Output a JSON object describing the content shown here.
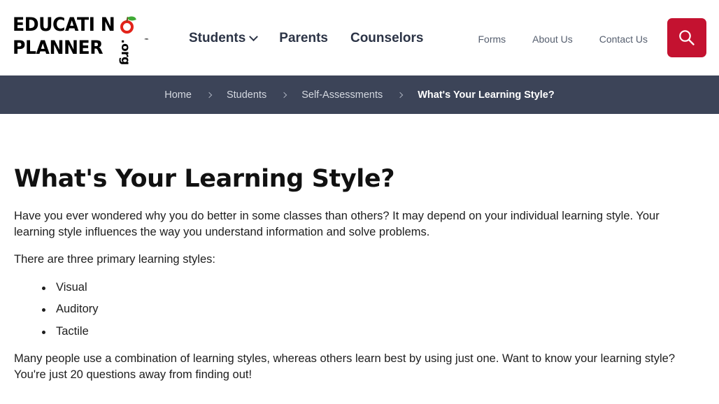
{
  "header": {
    "logo": {
      "line1": "EDUCATI N",
      "line2": "PLANNER",
      "suffix": ".org",
      "trademark": "™",
      "apple_color": "#e2231a",
      "leaf_color": "#3faa35"
    },
    "primary_nav": [
      {
        "label": "Students",
        "has_dropdown": true
      },
      {
        "label": "Parents",
        "has_dropdown": false
      },
      {
        "label": "Counselors",
        "has_dropdown": false
      }
    ],
    "secondary_nav": [
      {
        "label": "Forms"
      },
      {
        "label": "About Us"
      },
      {
        "label": "Contact Us"
      }
    ],
    "search": {
      "icon": "search-icon",
      "button_color": "#c41230",
      "aria_label": "Search"
    }
  },
  "breadcrumb": {
    "bar_color": "#3c4458",
    "items": [
      {
        "label": "Home",
        "current": false
      },
      {
        "label": "Students",
        "current": false
      },
      {
        "label": "Self-Assessments",
        "current": false
      },
      {
        "label": "What's Your Learning Style?",
        "current": true
      }
    ],
    "separator": "chevron-right-icon"
  },
  "main": {
    "title": "What's Your Learning Style?",
    "paragraph_1": "Have you ever wondered why you do better in some classes than others? It may depend on your individual learning style. Your learning style influences the way you understand information and solve problems.",
    "paragraph_2": "There are three primary learning styles:",
    "learning_styles": [
      "Visual",
      "Auditory",
      "Tactile"
    ],
    "paragraph_3": "Many people use a combination of learning styles, whereas others learn best by using just one. Want to know your learning style? You're just 20 questions away from finding out!"
  }
}
